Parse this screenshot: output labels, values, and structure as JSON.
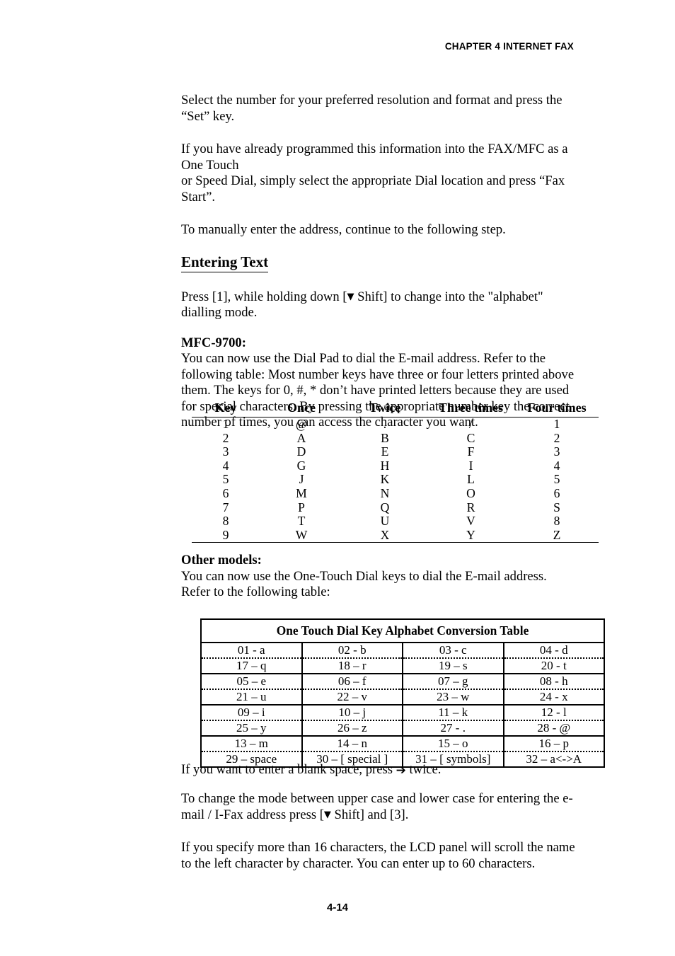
{
  "header": {
    "chapter_title": "CHAPTER 4 INTERNET FAX"
  },
  "body": {
    "para_1": "Select the number for your preferred resolution and format and press the “Set” key.",
    "para_2_line1": "If you have already programmed this information into the FAX/MFC as a One Touch",
    "para_2_line2": "or Speed Dial, simply select the appropriate Dial location and press “Fax Start”.",
    "para_3": "To manually enter the address, continue to the following step.",
    "heading_entering_text": "Entering Text",
    "para_4_before_arrow": "Press [1], while holding down [",
    "arrow_down_glyph": "▼",
    "para_4_after_arrow": " Shift] to change into the \"alphabet\" dialling mode.",
    "label_mfc9700": "MFC-9700:",
    "para_5": "You can now use the Dial Pad to dial the E-mail address.  Refer to the following table: Most number keys have three or four letters printed above them. The keys for 0, #,  * don’t have printed letters because they are used for special characters. By pressing the appropriate number key the correct number of times, you can access the character you want.",
    "label_other_models": "Other models:",
    "para_6": "You can now use the One-Touch Dial keys to dial the E-mail address.  Refer to the following table:",
    "para_7_before_arrow": "If you want to enter a blank space, press ",
    "arrow_right_glyph": "➔",
    "para_7_after_arrow": " twice.",
    "para_8_before_arrow": "To change the mode between upper case and lower case for entering the e-mail / I-Fax address press [",
    "para_8_after_arrow": " Shift] and [3].",
    "para_9": "If you specify more than 16 characters, the LCD panel will scroll the name to the left character by character. You can enter up to 60 characters."
  },
  "key_table": {
    "headers": [
      "Key",
      "Once",
      "Twice",
      "Three times",
      "Four times"
    ],
    "rows": [
      [
        "1",
        "@",
        ".",
        "/",
        "1"
      ],
      [
        "2",
        "A",
        "B",
        "C",
        "2"
      ],
      [
        "3",
        "D",
        "E",
        "F",
        "3"
      ],
      [
        "4",
        "G",
        "H",
        "I",
        "4"
      ],
      [
        "5",
        "J",
        "K",
        "L",
        "5"
      ],
      [
        "6",
        "M",
        "N",
        "O",
        "6"
      ],
      [
        "7",
        "P",
        "Q",
        "R",
        "S"
      ],
      [
        "8",
        "T",
        "U",
        "V",
        "8"
      ],
      [
        "9",
        "W",
        "X",
        "Y",
        "Z"
      ]
    ]
  },
  "conversion_table": {
    "title": "One Touch Dial Key Alphabet Conversion Table",
    "rows": [
      [
        "01 - a",
        "02 - b",
        "03 - c",
        "04 - d"
      ],
      [
        "17 – q",
        "18 – r",
        "19 – s",
        "20 - t"
      ],
      [
        "05 – e",
        "06 – f",
        "07 – g",
        "08 - h"
      ],
      [
        "21 – u",
        "22 – v",
        "23 – w",
        "24 - x"
      ],
      [
        "09 – i",
        "10 – j",
        "11 – k",
        "12 - l"
      ],
      [
        "25 – y",
        "26 – z",
        "27 - .",
        "28 - @"
      ],
      [
        "13 – m",
        "14 – n",
        "15 – o",
        "16 – p"
      ],
      [
        "29 – space",
        "30 – [ special ]",
        "31 – [ symbols]",
        "32 – a<->A"
      ]
    ]
  },
  "footer": {
    "page_number": "4-14"
  }
}
